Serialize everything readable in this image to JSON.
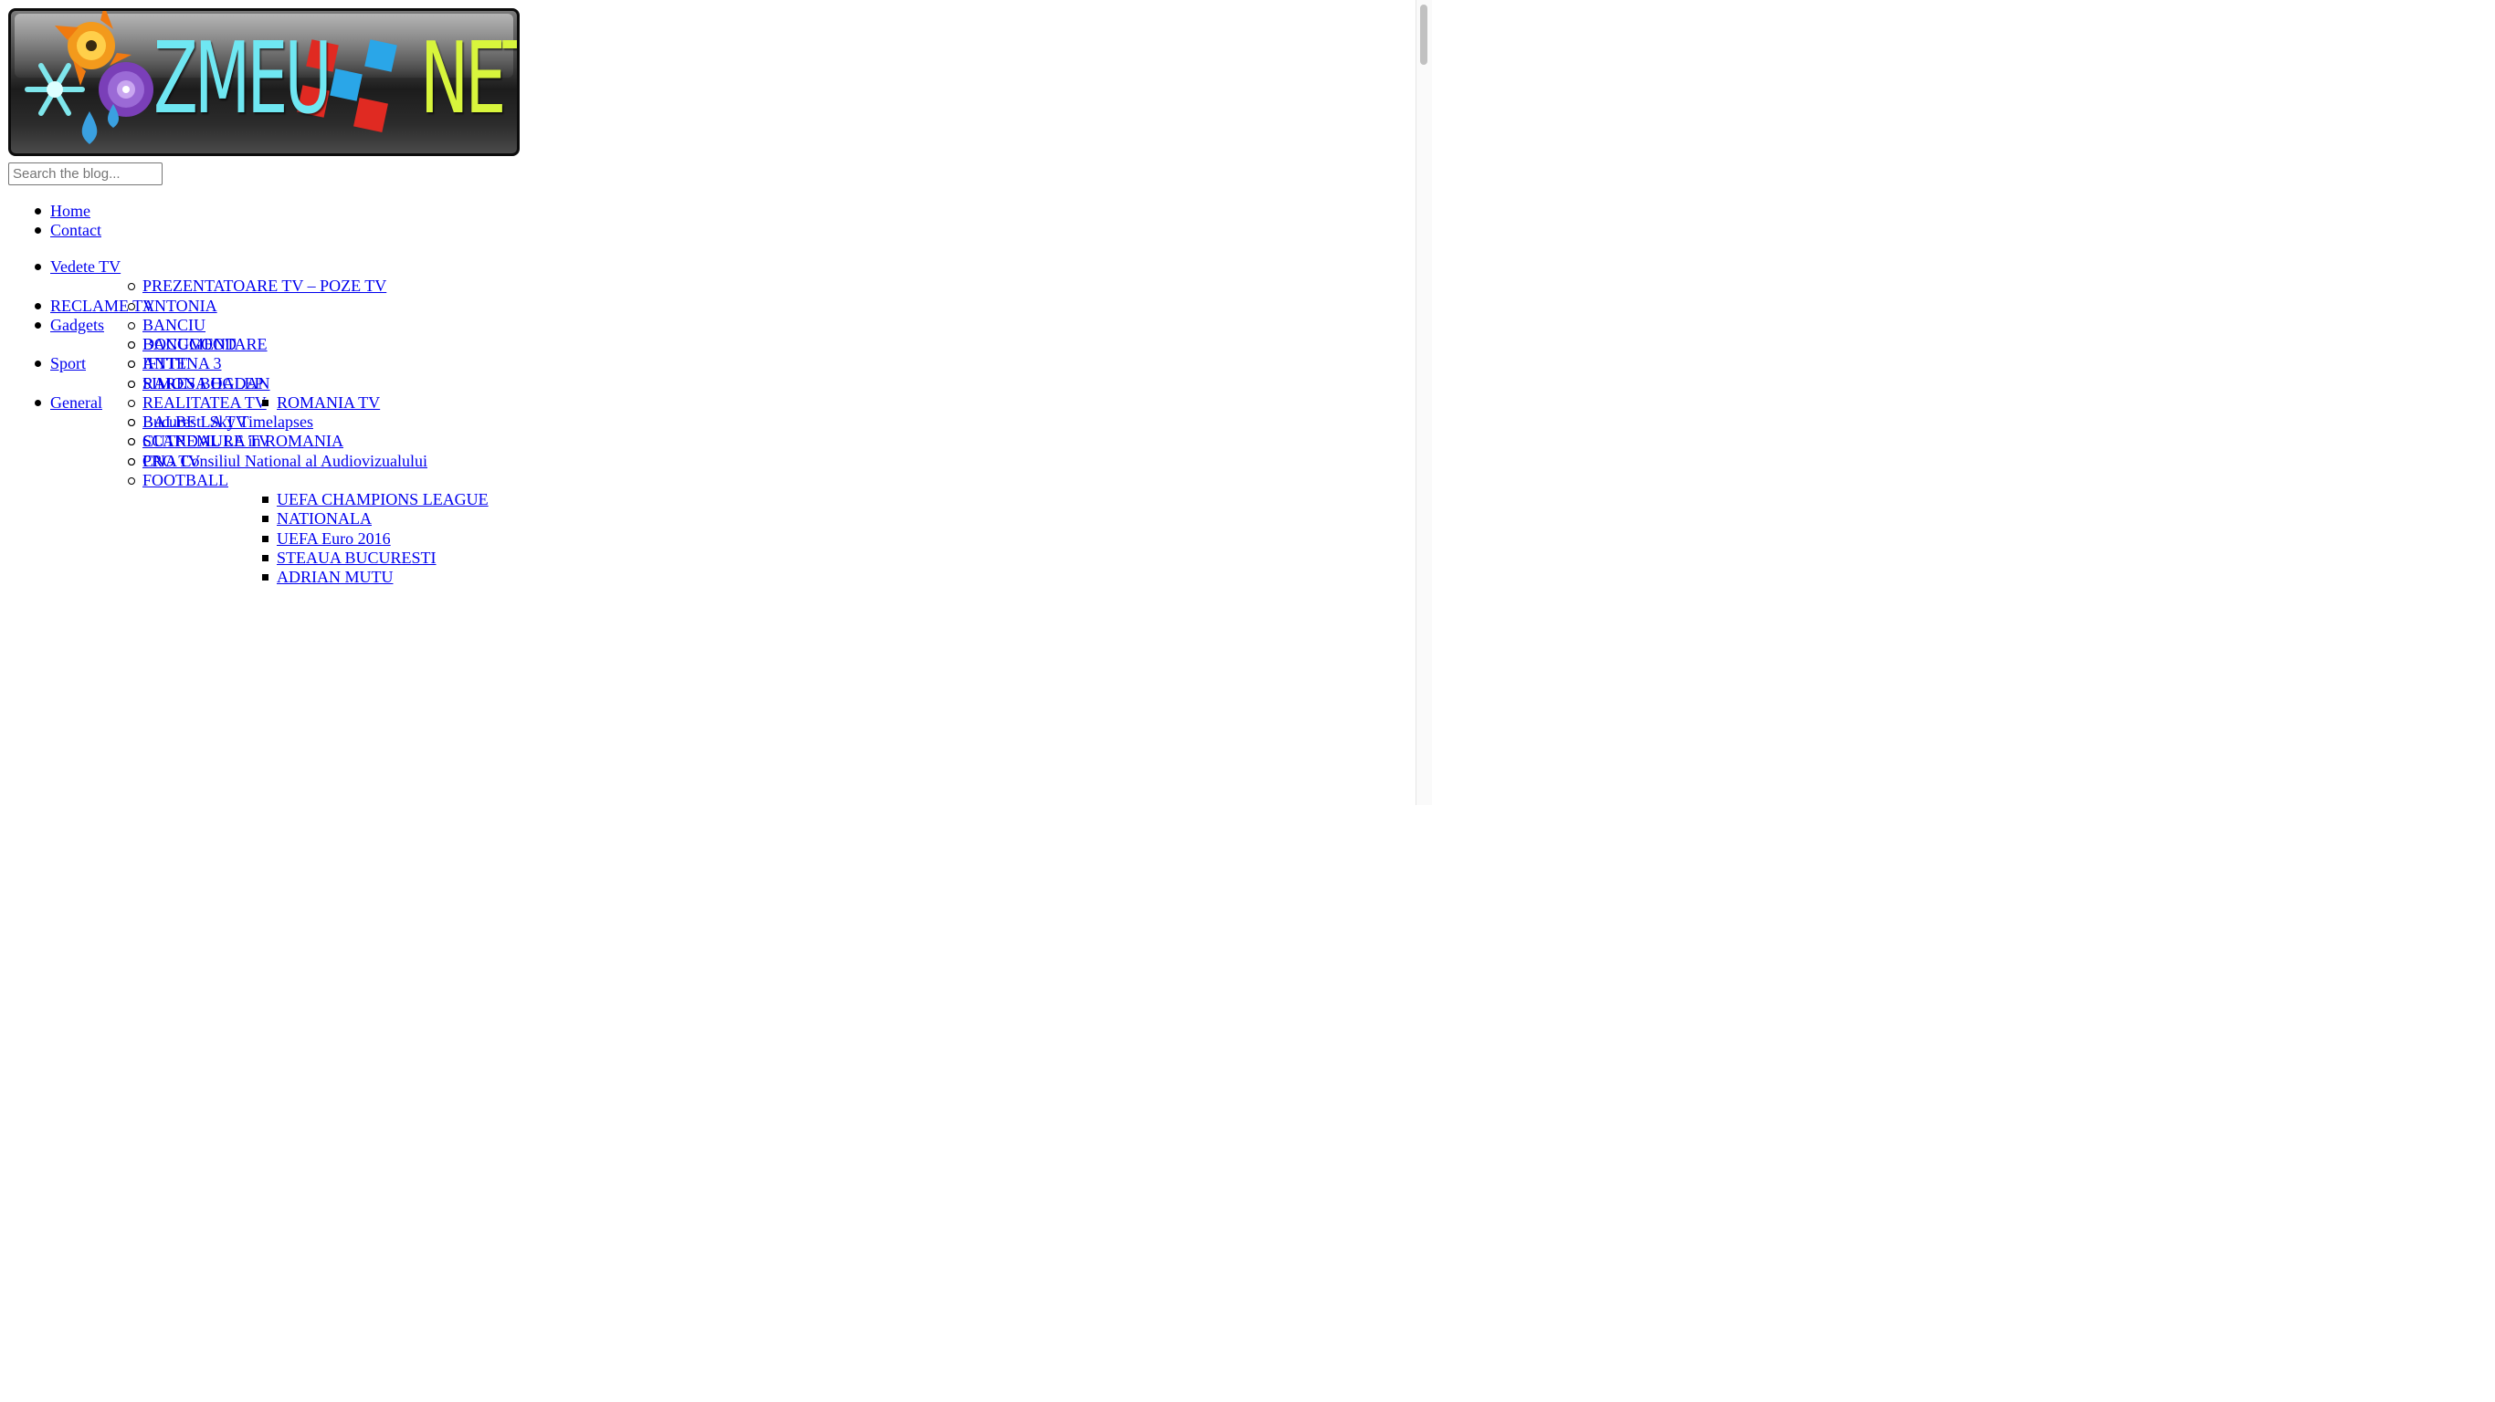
{
  "logo": {
    "text_left": "ZMEU",
    "text_right": "NET",
    "colors": {
      "left": "#6fe7f2",
      "right": "#d8f53c",
      "red_tile": "#e02a22",
      "blue_tile": "#2aa6e8"
    }
  },
  "search": {
    "placeholder": "Search the blog..."
  },
  "top_menu": [
    "Home",
    "Contact"
  ],
  "categories": [
    {
      "label": "Vedete TV",
      "children": [
        {
          "label": "PREZENTATOARE TV – POZE TV"
        },
        {
          "label": "ANTONIA"
        },
        {
          "label": "BANCIU"
        },
        {
          "label": "DOCUMENTARE"
        },
        {
          "label": "ANTENA 3"
        },
        {
          "label": "RARES BOGDAN"
        },
        {
          "label": "REALITATEA TV"
        },
        {
          "label": "BALBE LA TV"
        },
        {
          "label": "SCANDAL LA TV"
        },
        {
          "label": "PRO TV"
        }
      ]
    },
    {
      "label": "RECLAME TV"
    },
    {
      "label": "Gadgets",
      "children": [
        {
          "label": "BANGGOOD"
        },
        {
          "label": "IFTTT"
        }
      ]
    },
    {
      "label": "Sport",
      "children": [
        {
          "label": "SIMONA HALEP",
          "children": [
            {
              "label": "ROMANIA TV"
            }
          ]
        }
      ]
    },
    {
      "label": "General",
      "children": [
        {
          "label": "Bucuresti Sky Timelapses"
        },
        {
          "label": "CUTREMURE in ROMANIA"
        },
        {
          "label": "CNA Consiliul National al Audiovizualului"
        },
        {
          "label": "FOOTBALL",
          "children": [
            {
              "label": "UEFA CHAMPIONS LEAGUE"
            },
            {
              "label": "NATIONALA"
            },
            {
              "label": "UEFA Euro 2016"
            },
            {
              "label": "STEAUA BUCURESTI"
            },
            {
              "label": "ADRIAN MUTU"
            }
          ]
        }
      ]
    }
  ]
}
